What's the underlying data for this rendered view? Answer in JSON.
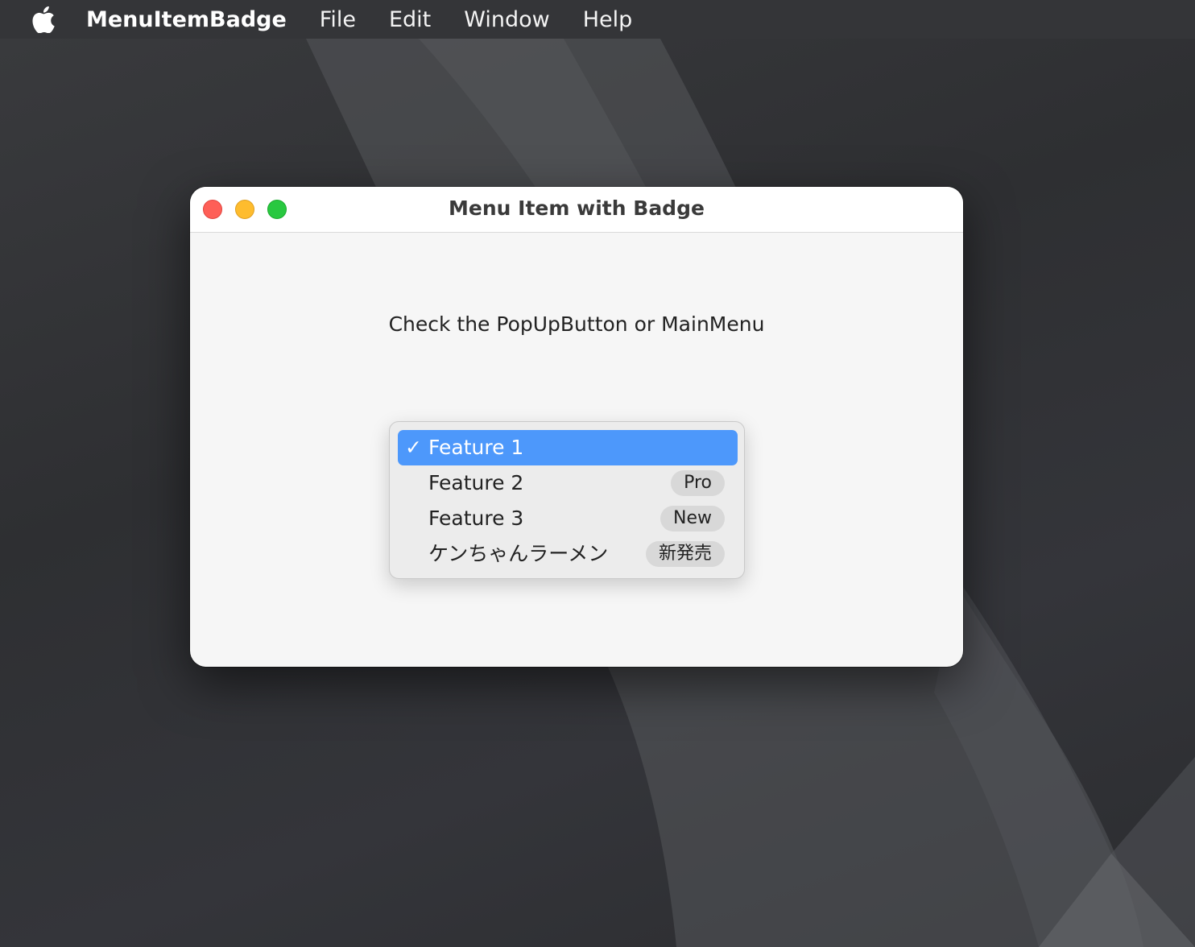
{
  "menubar": {
    "apple_icon": "apple-logo-icon",
    "app_name": "MenuItemBadge",
    "items": [
      "File",
      "Edit",
      "Window",
      "Help"
    ]
  },
  "window": {
    "title": "Menu Item with Badge",
    "instruction": "Check the PopUpButton or MainMenu",
    "popup": {
      "items": [
        {
          "label": "Feature 1",
          "selected": true,
          "badge": ""
        },
        {
          "label": "Feature 2",
          "selected": false,
          "badge": "Pro"
        },
        {
          "label": "Feature 3",
          "selected": false,
          "badge": "New"
        },
        {
          "label": "ケンちゃんラーメン",
          "selected": false,
          "badge": "新発売"
        }
      ],
      "check_glyph": "✓"
    }
  },
  "colors": {
    "selection": "#4d98fb",
    "close": "#fe5f57",
    "minimize": "#febc2e",
    "zoom": "#28c840",
    "badge_bg": "#d8d8d8"
  }
}
